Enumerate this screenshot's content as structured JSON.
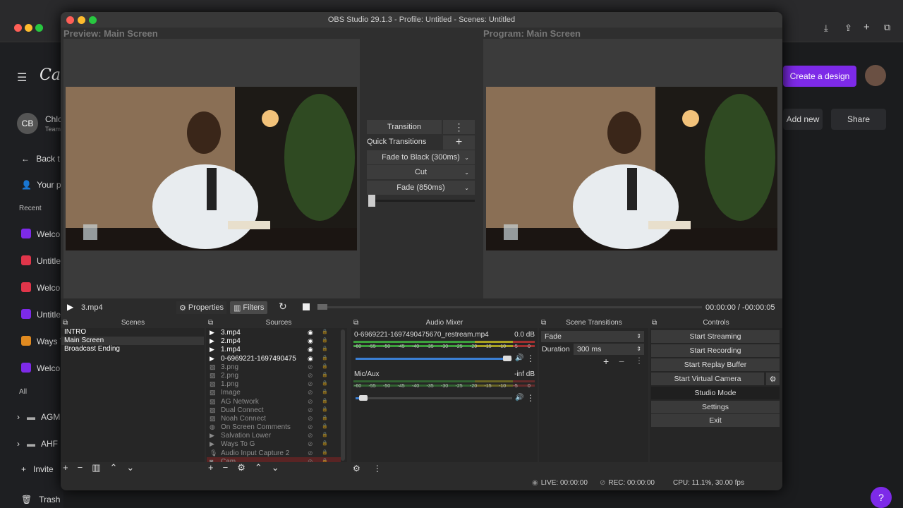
{
  "background": {
    "logo": "Ca",
    "avatar_initials": "CB",
    "user_name": "Chlo",
    "user_team": "Team",
    "nav": [
      "Back t",
      "Your p"
    ],
    "recent_label": "Recent",
    "recent": [
      "Welco",
      "Untitle",
      "Welco",
      "Untitle",
      "Ways T",
      "Welco"
    ],
    "all_label": "All",
    "folders": [
      "AGM",
      "AHF"
    ],
    "invite": "Invite",
    "trash": "Trash",
    "create_design": "Create a design",
    "add_new": "Add new",
    "share": "Share",
    "help": "?"
  },
  "obs": {
    "window_title": "OBS Studio 29.1.3 - Profile: Untitled - Scenes: Untitled",
    "preview_title": "Preview: Main Screen",
    "program_title": "Program: Main Screen",
    "transition_label": "Transition",
    "quick_transitions_label": "Quick Transitions",
    "quick_transitions": [
      "Fade to Black (300ms)",
      "Cut",
      "Fade (850ms)"
    ],
    "media": {
      "name": "3.mp4",
      "properties": "Properties",
      "filters": "Filters",
      "time_current": "00:00:00",
      "time_sep": "/",
      "time_remaining": "-00:00:05"
    },
    "docks": {
      "scenes": "Scenes",
      "sources": "Sources",
      "audio_mixer": "Audio Mixer",
      "scene_transitions": "Scene Transitions",
      "controls": "Controls"
    },
    "scenes": [
      "INTRO",
      "Main Screen",
      "Broadcast Ending"
    ],
    "selected_scene": 1,
    "sources": [
      {
        "name": "3.mp4",
        "type": "media",
        "visible": true
      },
      {
        "name": "2.mp4",
        "type": "media",
        "visible": true
      },
      {
        "name": "1.mp4",
        "type": "media",
        "visible": true
      },
      {
        "name": "0-6969221-1697490475",
        "type": "media",
        "visible": true
      },
      {
        "name": "3.png",
        "type": "image",
        "visible": false
      },
      {
        "name": "2.png",
        "type": "image",
        "visible": false
      },
      {
        "name": "1.png",
        "type": "image",
        "visible": false
      },
      {
        "name": "Image",
        "type": "image",
        "visible": false
      },
      {
        "name": "AG Network",
        "type": "image",
        "visible": false
      },
      {
        "name": "Dual Connect",
        "type": "image",
        "visible": false
      },
      {
        "name": "Noah Connect",
        "type": "image",
        "visible": false
      },
      {
        "name": "On Screen Comments",
        "type": "browser",
        "visible": false
      },
      {
        "name": "Salvation Lower",
        "type": "media",
        "visible": false
      },
      {
        "name": "Ways To G",
        "type": "media",
        "visible": false
      },
      {
        "name": "Audio Input Capture 2",
        "type": "audio",
        "visible": false
      },
      {
        "name": "Cam",
        "type": "camera",
        "visible": false
      }
    ],
    "audio": [
      {
        "name": "0-6969221-1697490475670_restream.mp4",
        "level": "0.0 dB",
        "fader": 0.97
      },
      {
        "name": "Mic/Aux",
        "level": "-inf dB",
        "fader": 0.05
      }
    ],
    "meter_ticks": [
      "-60",
      "-55",
      "-50",
      "-45",
      "-40",
      "-35",
      "-30",
      "-25",
      "-20",
      "-15",
      "-10",
      "-5",
      "0"
    ],
    "scene_transition": {
      "type": "Fade",
      "duration_label": "Duration",
      "duration": "300 ms"
    },
    "controls": [
      "Start Streaming",
      "Start Recording",
      "Start Replay Buffer",
      "Start Virtual Camera",
      "Studio Mode",
      "Settings",
      "Exit"
    ],
    "status": {
      "live": "LIVE: 00:00:00",
      "rec": "REC: 00:00:00",
      "cpu": "CPU: 11.1%, 30.00 fps"
    },
    "colors": {
      "accent_purple": "#7d2ae8",
      "meter_green": "#3fae3f",
      "meter_yellow": "#b8b020",
      "meter_red": "#b03030",
      "fader_blue": "#3b7fd4"
    }
  }
}
